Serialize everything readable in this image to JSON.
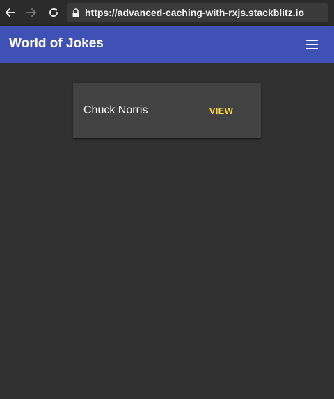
{
  "browser": {
    "url": "https://advanced-caching-with-rxjs.stackblitz.io",
    "icons": {
      "back": "arrow-left-icon",
      "forward": "arrow-right-icon",
      "reload": "reload-icon",
      "lock": "lock-icon"
    }
  },
  "toolbar": {
    "title": "World of Jokes",
    "menu_icon": "hamburger-menu-icon",
    "color": "#3f51b5"
  },
  "main": {
    "cards": [
      {
        "title": "Chuck Norris",
        "action_label": "VIEW"
      }
    ]
  },
  "colors": {
    "background": "#303030",
    "card": "#424242",
    "accent": "#ffd740"
  }
}
